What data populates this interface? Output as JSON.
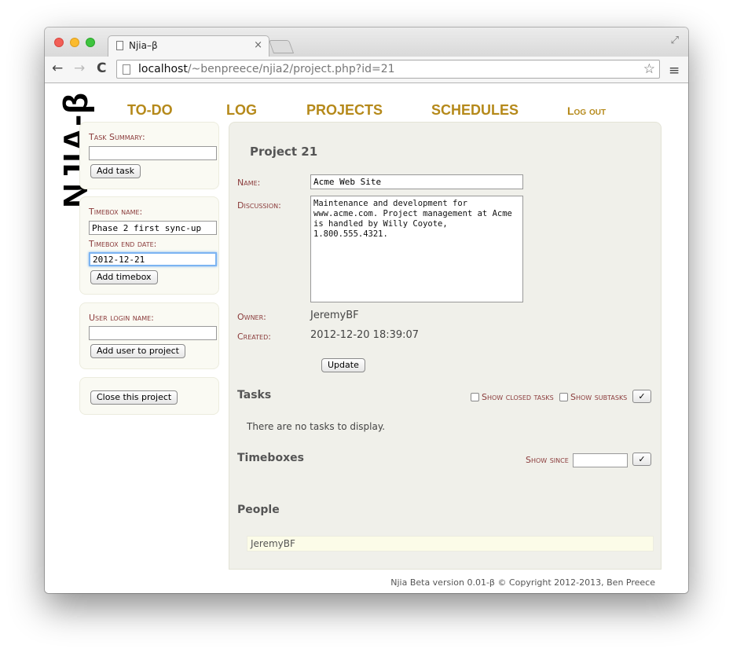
{
  "browser": {
    "tab_title": "Njia–β",
    "tab_close": "×",
    "url_host": "localhost",
    "url_path": "/~benpreece/njia2/project.php?id=21",
    "back_icon": "←",
    "forward_icon": "→",
    "reload_icon": "C",
    "star_icon": "☆",
    "menu_icon": "≡",
    "fullscreen_icon": "⤢"
  },
  "logo": "NJIA-β",
  "nav": {
    "todo": "TO-DO",
    "log": "LOG",
    "projects": "PROJECTS",
    "schedules": "SCHEDULES",
    "logout": "Log out"
  },
  "sidebar": {
    "task_label": "Task Summary:",
    "task_value": "",
    "add_task": "Add task",
    "timebox_name_label": "Timebox name:",
    "timebox_name_value": "Phase 2 first sync-up",
    "timebox_end_label": "Timebox end date:",
    "timebox_end_value": "2012-12-21",
    "add_timebox": "Add timebox",
    "user_login_label": "User login name:",
    "user_login_value": "",
    "add_user": "Add user to project",
    "close_project": "Close this project"
  },
  "project": {
    "title": "Project 21",
    "name_label": "Name:",
    "name_value": "Acme Web Site",
    "discussion_label": "Discussion:",
    "discussion_value": "Maintenance and development for www.acme.com.  Project management at Acme is handled by Willy Coyote, 1.800.555.4321.",
    "owner_label": "Owner:",
    "owner_value": "JeremyBF",
    "created_label": "Created:",
    "created_value": "2012-12-20 18:39:07",
    "update_button": "Update"
  },
  "tasks": {
    "heading": "Tasks",
    "show_closed": "Show closed tasks",
    "show_subtasks": "Show subtasks",
    "apply": "✓",
    "empty_message": "There are no tasks to display."
  },
  "timeboxes": {
    "heading": "Timeboxes",
    "show_since": "Show since",
    "show_since_value": "",
    "apply": "✓"
  },
  "people": {
    "heading": "People",
    "members": [
      "JeremyBF"
    ]
  },
  "footer": "Njia Beta version 0.01-β © Copyright 2012-2013, Ben Preece"
}
